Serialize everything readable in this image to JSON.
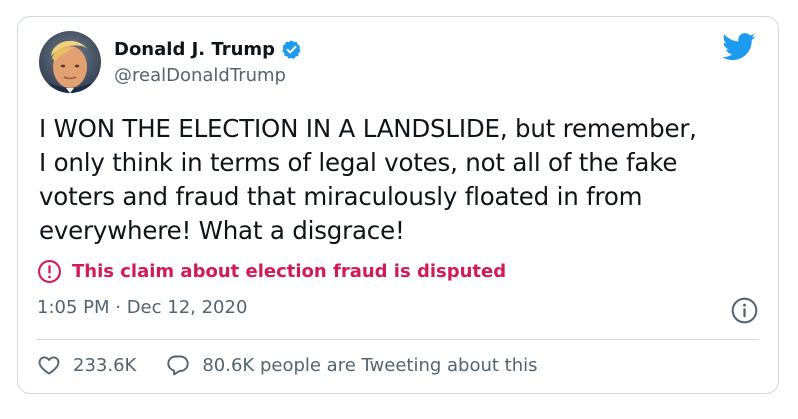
{
  "author": {
    "display_name": "Donald J. Trump",
    "handle": "@realDonaldTrump",
    "verified": true
  },
  "tweet": {
    "lines": [
      "I WON THE ELECTION IN A LANDSLIDE, but remember,",
      "I only think in terms of legal votes, not all of the fake",
      "voters and fraud that miraculously floated in from",
      "everywhere! What a disgrace!"
    ]
  },
  "notice": {
    "text": "This claim about election fraud is disputed",
    "icon": "exclamation-circle-icon",
    "color": "#d11a56"
  },
  "meta": {
    "timestamp": "1:05 PM · Dec 12, 2020"
  },
  "stats": {
    "likes": "233.6K",
    "replies": "80.6K people are Tweeting about this"
  },
  "colors": {
    "brand": "#1d9bf0",
    "secondary_text": "#536471",
    "border": "#cfd9de"
  }
}
